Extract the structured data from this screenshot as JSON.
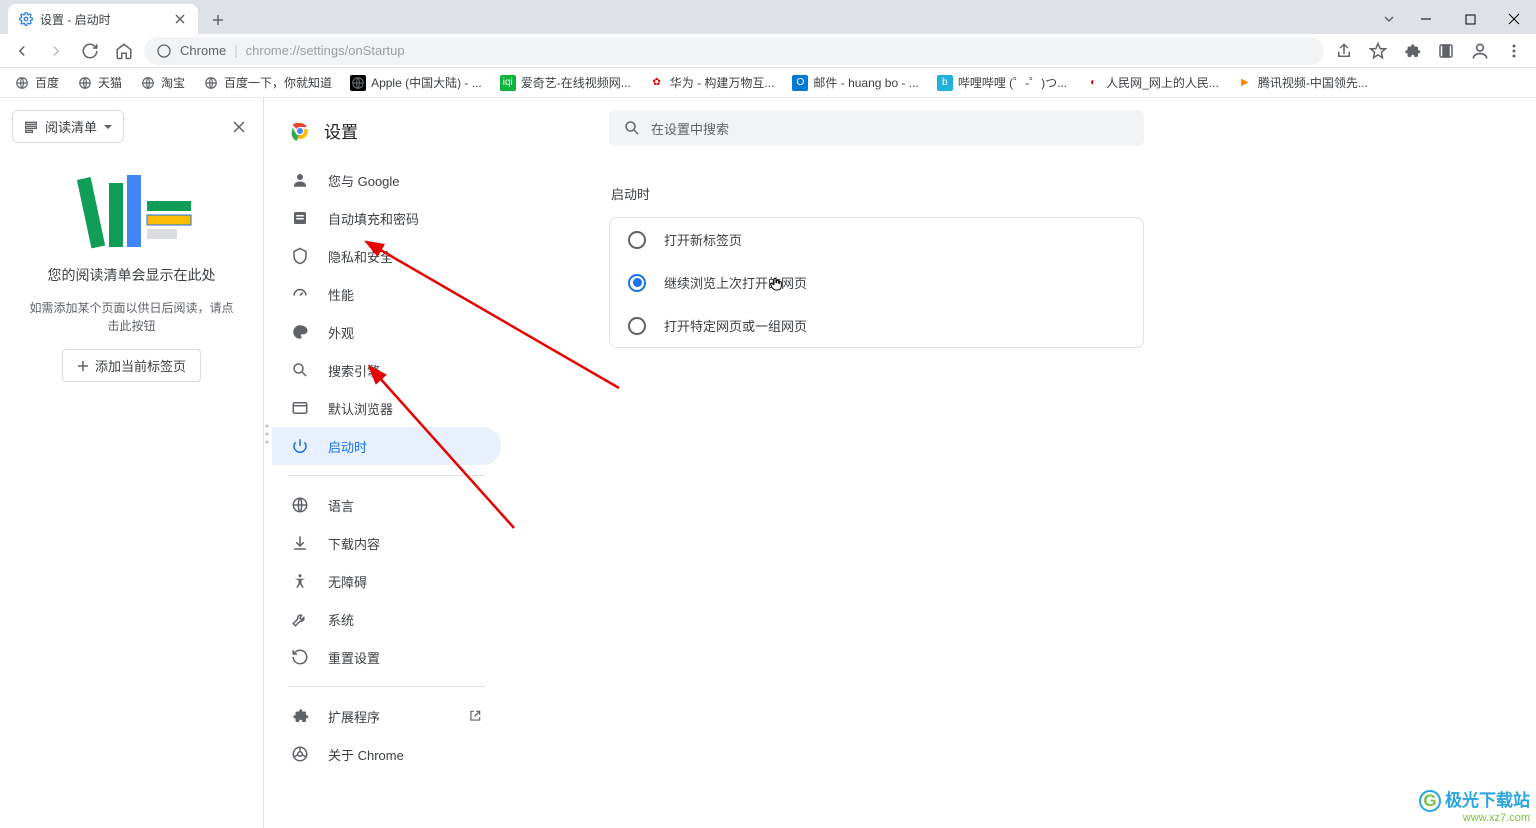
{
  "tab": {
    "title": "设置 - 启动时"
  },
  "toolbar": {
    "origin": "Chrome",
    "path": "chrome://settings/onStartup"
  },
  "bookmarks": [
    {
      "label": "百度",
      "color": "#fff",
      "text": "#5f6368"
    },
    {
      "label": "天猫",
      "color": "#fff",
      "text": "#5f6368"
    },
    {
      "label": "淘宝",
      "color": "#fff",
      "text": "#5f6368"
    },
    {
      "label": "百度一下，你就知道",
      "color": "#fff",
      "text": "#5f6368"
    },
    {
      "label": "Apple (中国大陆) - ...",
      "color": "#000",
      "text": "#fff",
      "glyph": ""
    },
    {
      "label": "爱奇艺-在线视频网...",
      "color": "#12b33d",
      "text": "#fff",
      "glyph": "iqi"
    },
    {
      "label": "华为 - 构建万物互...",
      "color": "#fff",
      "text": "#d40000",
      "glyph": "✿"
    },
    {
      "label": "邮件 - huang bo - ...",
      "color": "#0078d4",
      "text": "#fff",
      "glyph": "O"
    },
    {
      "label": "哔哩哔哩 (゜-゜)つ...",
      "color": "#20b2de",
      "text": "#fff",
      "glyph": "b"
    },
    {
      "label": "人民网_网上的人民...",
      "color": "#fff",
      "text": "#d40000",
      "glyph": "◐"
    },
    {
      "label": "腾讯视频-中国领先...",
      "color": "#fff",
      "text": "#ff8a00",
      "glyph": "▶"
    }
  ],
  "reading_panel": {
    "dropdown": "阅读清单",
    "heading": "您的阅读清单会显示在此处",
    "subtitle": "如需添加某个页面以供日后阅读，请点击此按钮",
    "button": "添加当前标签页"
  },
  "settings": {
    "title": "设置",
    "search_placeholder": "在设置中搜索",
    "nav": {
      "you_google": "您与 Google",
      "autofill": "自动填充和密码",
      "privacy": "隐私和安全",
      "performance": "性能",
      "appearance": "外观",
      "search": "搜索引擎",
      "default_browser": "默认浏览器",
      "on_startup": "启动时",
      "languages": "语言",
      "downloads": "下载内容",
      "accessibility": "无障碍",
      "system": "系统",
      "reset": "重置设置",
      "extensions": "扩展程序",
      "about": "关于 Chrome"
    },
    "section_title": "启动时",
    "options": {
      "new_tab": "打开新标签页",
      "continue": "继续浏览上次打开的网页",
      "specific": "打开特定网页或一组网页"
    }
  },
  "watermark": {
    "line1": "极光下载站",
    "line2": "www.xz7.com"
  }
}
